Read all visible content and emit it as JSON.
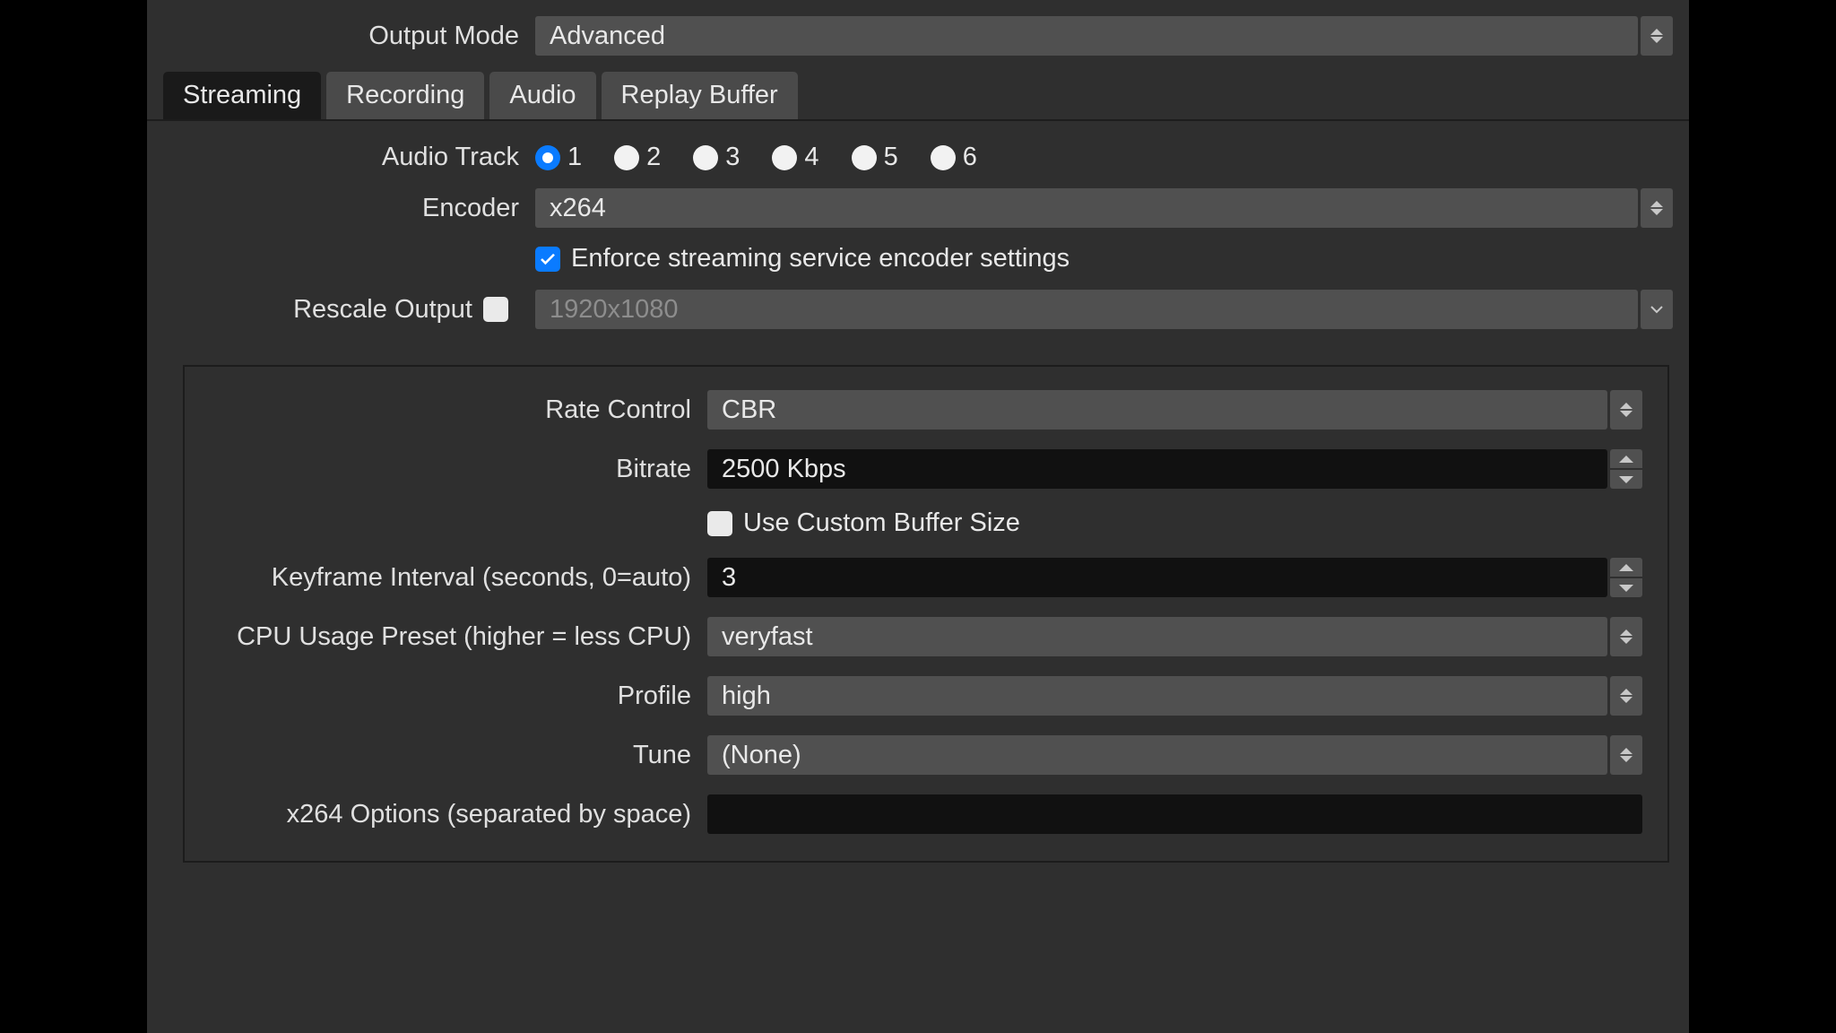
{
  "output_mode": {
    "label": "Output Mode",
    "value": "Advanced"
  },
  "tabs": [
    "Streaming",
    "Recording",
    "Audio",
    "Replay Buffer"
  ],
  "active_tab": 0,
  "audio_track": {
    "label": "Audio Track",
    "options": [
      "1",
      "2",
      "3",
      "4",
      "5",
      "6"
    ],
    "selected": 0
  },
  "encoder": {
    "label": "Encoder",
    "value": "x264"
  },
  "enforce": {
    "label": "Enforce streaming service encoder settings",
    "checked": true
  },
  "rescale": {
    "label": "Rescale Output",
    "checked": false,
    "value": "1920x1080"
  },
  "enc": {
    "rate_control": {
      "label": "Rate Control",
      "value": "CBR"
    },
    "bitrate": {
      "label": "Bitrate",
      "value": "2500 Kbps"
    },
    "custom_buffer": {
      "label": "Use Custom Buffer Size",
      "checked": false
    },
    "keyframe": {
      "label": "Keyframe Interval (seconds, 0=auto)",
      "value": "3"
    },
    "cpu_preset": {
      "label": "CPU Usage Preset (higher = less CPU)",
      "value": "veryfast"
    },
    "profile": {
      "label": "Profile",
      "value": "high"
    },
    "tune": {
      "label": "Tune",
      "value": "(None)"
    },
    "x264_opts": {
      "label": "x264 Options (separated by space)",
      "value": ""
    }
  }
}
